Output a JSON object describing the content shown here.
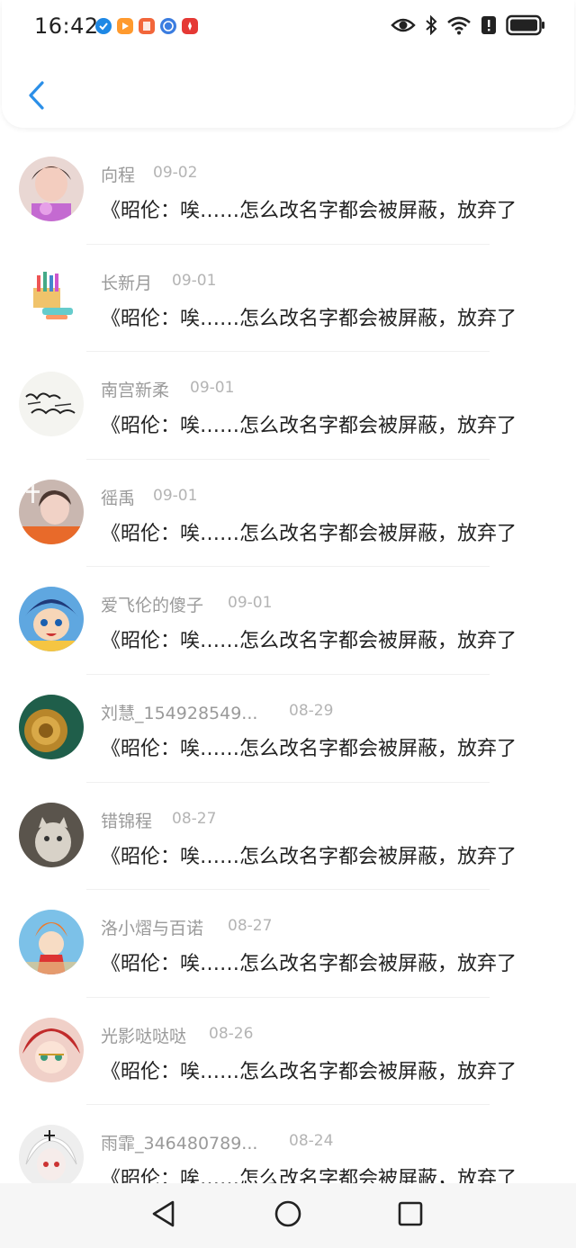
{
  "status_bar": {
    "time": "16:42",
    "app_icons": [
      "check-badge-icon",
      "video-app-icon",
      "book-app-icon",
      "browser-app-icon",
      "huawei-app-icon"
    ],
    "right_icons": [
      "eye-icon",
      "bluetooth-icon",
      "wifi-icon",
      "alert-icon",
      "battery-icon"
    ]
  },
  "header": {
    "back_icon": "chevron-left-icon",
    "accent_color": "#2b8fe8"
  },
  "comments": [
    {
      "name": "向程",
      "date": "09-02",
      "message": "《昭伦：唉……怎么改名字都会被屏蔽，放弃了",
      "avatar": "avatar-girl-photo"
    },
    {
      "name": "长新月",
      "date": "09-01",
      "message": "《昭伦：唉……怎么改名字都会被屏蔽，放弃了",
      "avatar": "avatar-pencils"
    },
    {
      "name": "南宫新柔",
      "date": "09-01",
      "message": "《昭伦：唉……怎么改名字都会被屏蔽，放弃了",
      "avatar": "avatar-calligraphy"
    },
    {
      "name": "徭禹",
      "date": "09-01",
      "message": "《昭伦：唉……怎么改名字都会被屏蔽，放弃了",
      "avatar": "avatar-girl-photo-2"
    },
    {
      "name": "爱飞伦的傻子",
      "date": "09-01",
      "message": "《昭伦：唉……怎么改名字都会被屏蔽，放弃了",
      "avatar": "avatar-anime-boy"
    },
    {
      "name": "刘慧_154928549...",
      "date": "08-29",
      "message": "《昭伦：唉……怎么改名字都会被屏蔽，放弃了",
      "avatar": "avatar-gold-flower"
    },
    {
      "name": "错锦程",
      "date": "08-27",
      "message": "《昭伦：唉……怎么改名字都会被屏蔽，放弃了",
      "avatar": "avatar-cat"
    },
    {
      "name": "洛小熠与百诺",
      "date": "08-27",
      "message": "《昭伦：唉……怎么改名字都会被屏蔽，放弃了",
      "avatar": "avatar-anime-red"
    },
    {
      "name": "光影哒哒哒",
      "date": "08-26",
      "message": "《昭伦：唉……怎么改名字都会被屏蔽，放弃了",
      "avatar": "avatar-anime-girl-red"
    },
    {
      "name": "雨霏_346480789...",
      "date": "08-24",
      "message": "《昭伦：唉……怎么改名字都会被屏蔽，放弃了",
      "avatar": "avatar-anime-girl-white"
    }
  ],
  "nav_bar": {
    "icons": [
      "back-triangle-icon",
      "home-circle-icon",
      "recents-square-icon"
    ]
  }
}
